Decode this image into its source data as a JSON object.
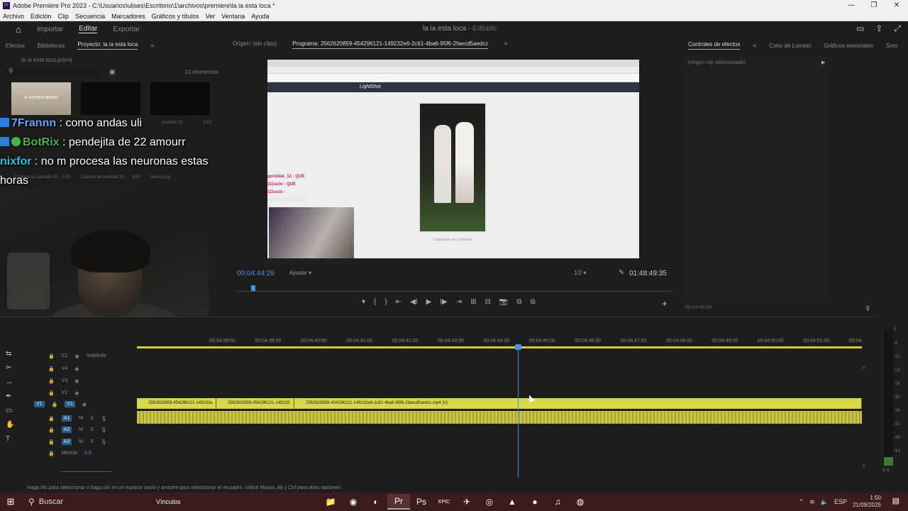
{
  "window": {
    "title": "Adobe Premiere Pro 2023 - C:\\Usuarios\\ulises\\Escritorio\\1\\archivos\\premiere\\la ia esta loca *",
    "controls": [
      "—",
      "❐",
      "✕"
    ]
  },
  "menu": [
    "Archivo",
    "Edición",
    "Clip",
    "Secuencia",
    "Marcadores",
    "Gráficos y títulos",
    "Ver",
    "Ventana",
    "Ayuda"
  ],
  "workspace": {
    "tabs": [
      "Importar",
      "Editar",
      "Exportar"
    ],
    "active": "Editar",
    "project_title": "la ia esta loca",
    "project_status": "Editado"
  },
  "project_panel": {
    "tabs": [
      "Efectos",
      "Bibliotecas",
      "Proyecto: la ia esta loca"
    ],
    "file": "la ia esta loca.prproj",
    "item_count": "10 elementos",
    "thumb_labels": [
      {
        "name": "Captura de pantalla 20...",
        "dur": "2:02"
      },
      {
        "name": "pantalla 20...",
        "dur": "5:00"
      },
      {
        "name": "Captura de pantalla 20...",
        "dur": "5:00"
      },
      {
        "name": "momo.png",
        "dur": ""
      }
    ],
    "thumb_overlay": "a comenzamos"
  },
  "chat": [
    {
      "user": "7Frannn",
      "msg": ": como andas uli"
    },
    {
      "user": "BotRix",
      "msg": ": pendejita de 22 amourr"
    },
    {
      "user": "nixfor",
      "msg": ": no m procesa las neuronas estas"
    },
    {
      "user": "",
      "msg": "horas"
    }
  ],
  "program_monitor": {
    "tabs": [
      "Origen: (sin clips)",
      "Programa: 2562620859-454296121-149232e6-2c61-4ba6-95f6-2faecd5aedcc"
    ],
    "timecode_current": "00:04:44:29",
    "fit": "Ajustar",
    "resolution": "1/2",
    "timecode_total": "01:48:49:35",
    "transport": [
      "▾",
      "{",
      "}",
      "⇤",
      "◀I",
      "▶",
      "I▶",
      "⇥",
      "⊞",
      "⊟",
      "📷",
      "⧉",
      "⧉"
    ],
    "add_button": "+",
    "video_text": {
      "site": "LightShot",
      "chat_lines": [
        "gonzilax_13 : QUE",
        "111uclo : QUE",
        "111uclo :",
        "AMIGAAAAAAAAA"
      ],
      "caption": "Capturado con Lightshot"
    }
  },
  "effects_panel": {
    "tabs": [
      "Controles de efectos",
      "Color de Lumetri",
      "Gráficos esenciales",
      "Soni"
    ],
    "empty_label": "(ningún clip seleccionado)",
    "timecode": "00:04:44:29"
  },
  "timeline": {
    "ruler": [
      "00:04:38:00",
      "00:04:39:00",
      "00:04:40:00",
      "00:04:41:00",
      "00:04:42:00",
      "00:04:43:00",
      "00:04:44:00",
      "00:04:45:00",
      "00:04:46:00",
      "00:04:47:00",
      "00:04:48:00",
      "00:04:49:00",
      "00:04:50:00",
      "00:04:51:00",
      "00:04:"
    ],
    "tracks": [
      {
        "id": "C1",
        "label": "Subtítulo"
      },
      {
        "id": "V4",
        "label": ""
      },
      {
        "id": "V3",
        "label": ""
      },
      {
        "id": "V2",
        "label": ""
      },
      {
        "id": "V1",
        "label": "V1"
      },
      {
        "id": "A1",
        "label": "A1"
      },
      {
        "id": "A2",
        "label": "A2"
      },
      {
        "id": "A3",
        "label": "A3"
      }
    ],
    "mix_label": "Mezcla",
    "mix_value": "0,0",
    "clips": [
      "2562620859-454296121-149232e",
      "2562620859-454296121-149232",
      "2562620859-454296121-149232e6-2c61-4ba6-95f6-2faecd5aedcc.mp4 [V]"
    ]
  },
  "meter": {
    "levels": [
      "0",
      "-6",
      "-12",
      "-18",
      "-24",
      "-30",
      "-36",
      "-42",
      "-48",
      "-54"
    ],
    "solo": "S S"
  },
  "status_bar": "Haga clic para seleccionar o haga clic en un espacio vacío y arrastre para seleccionar el recuadro. Utilice Mayús, Alt y Ctrl para otras opciones.",
  "taskbar": {
    "search_placeholder": "Buscar",
    "widget_label": "Vínculos",
    "apps": [
      "📁",
      "◉",
      "◐",
      "Pr",
      "Ps",
      "EPIC",
      "✈",
      "◎",
      "▲",
      "●",
      "♫",
      "◍"
    ],
    "active_app": "Pr",
    "lang": "ESP",
    "time": "1:50",
    "date": "21/09/2025"
  }
}
